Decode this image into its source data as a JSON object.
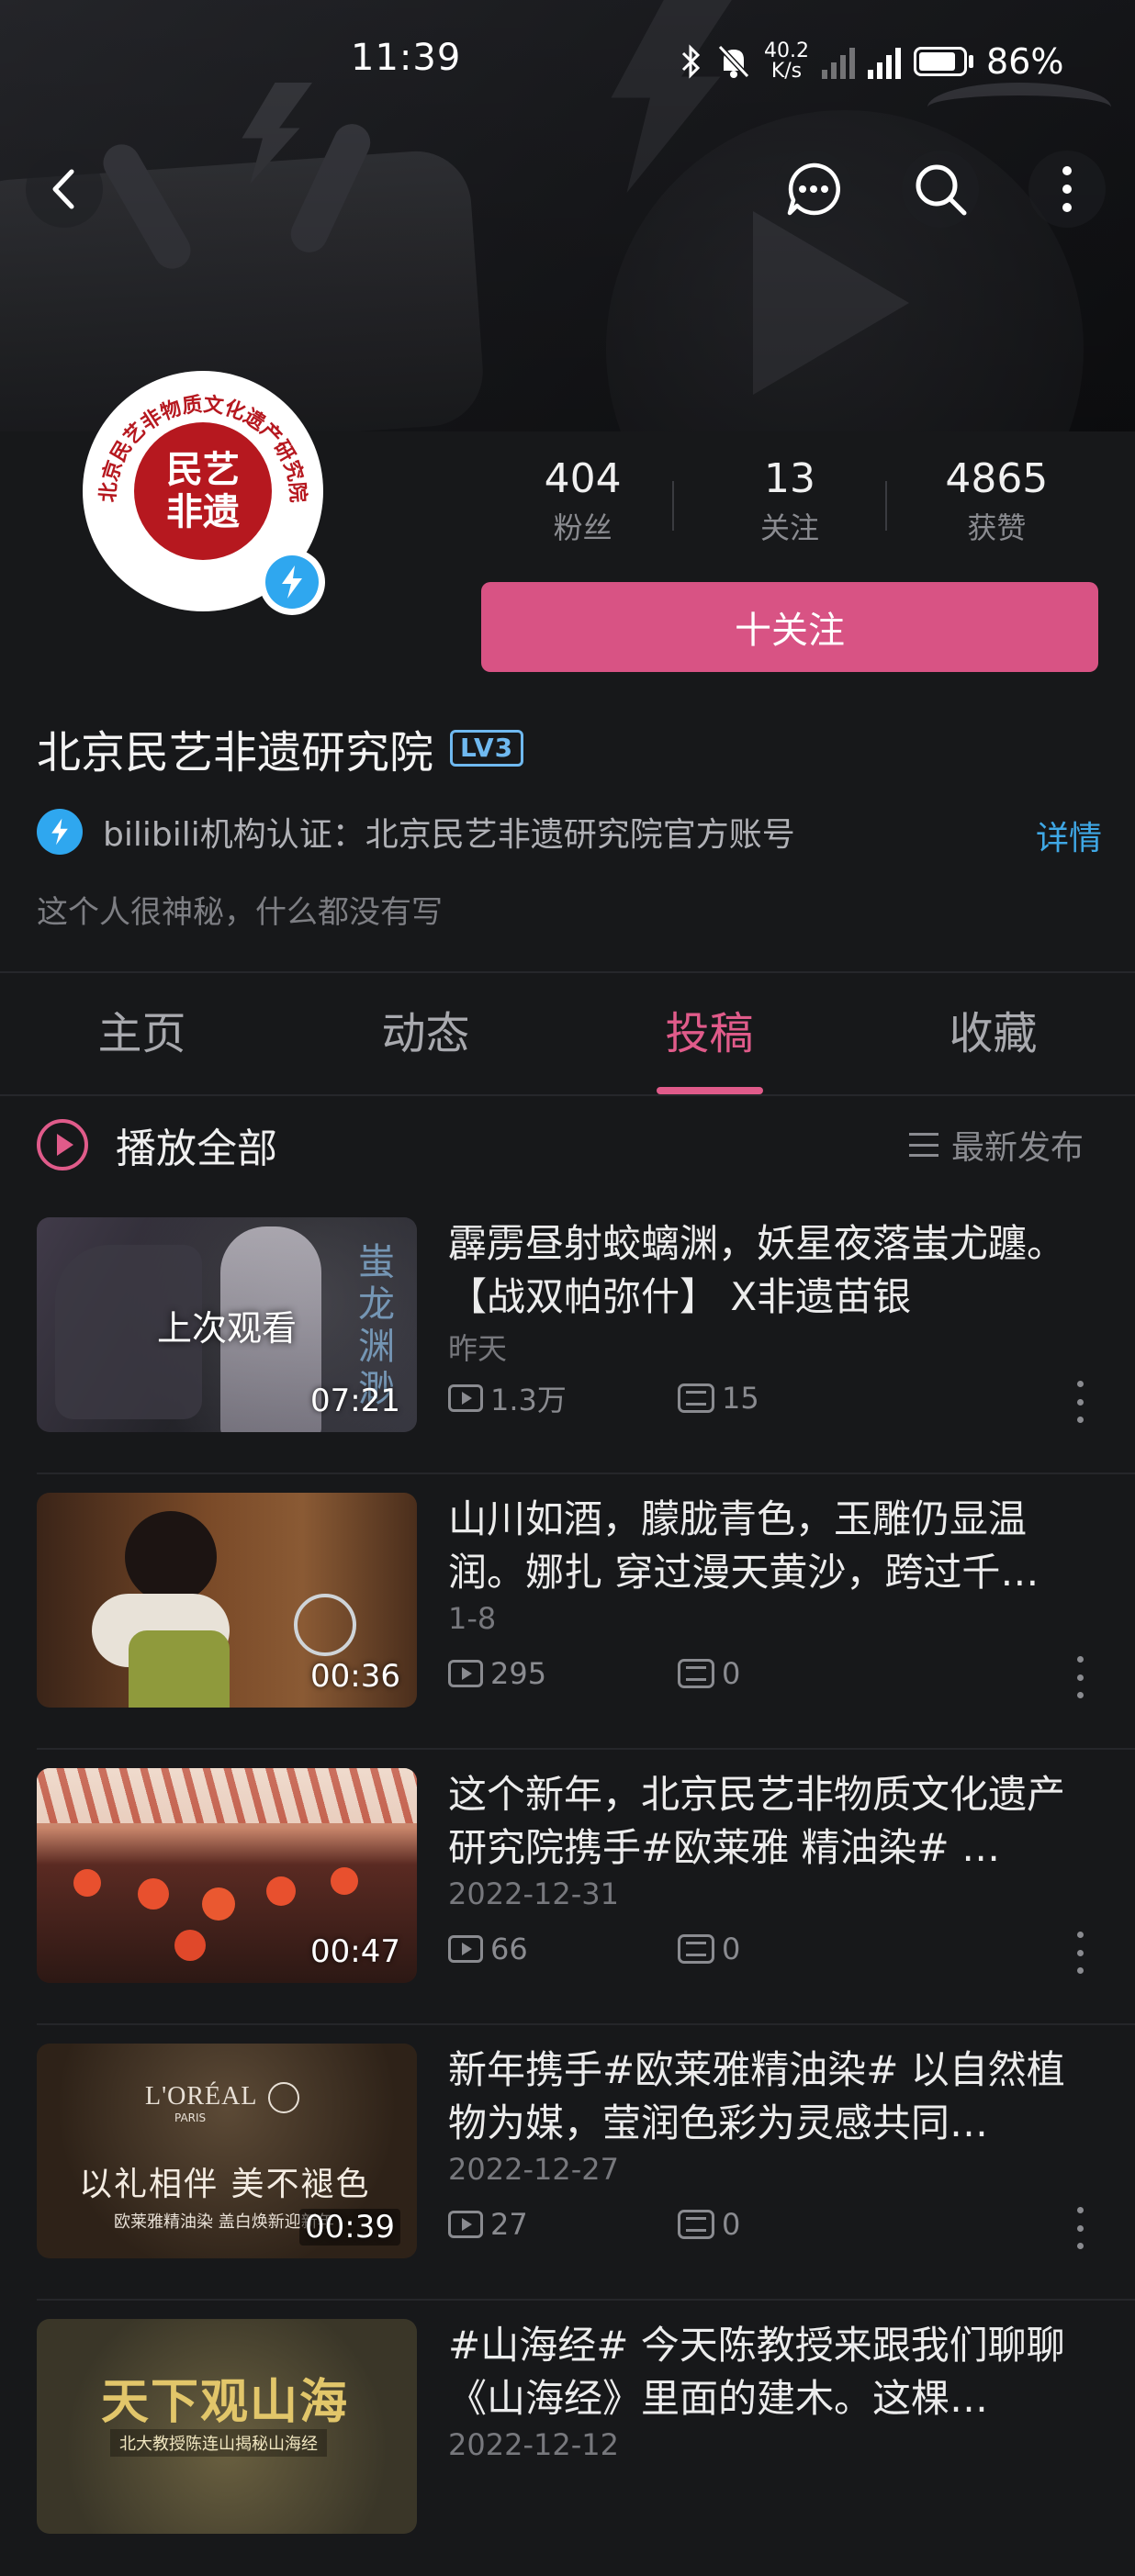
{
  "status_bar": {
    "time": "11:39",
    "net_speed_top": "40.2",
    "net_speed_bottom": "K/s",
    "battery": "86%"
  },
  "nav": {
    "back_icon": "chevron-left-icon",
    "chat_icon": "chat-bubble-icon",
    "search_icon": "search-icon",
    "more_icon": "more-vertical-icon"
  },
  "profile": {
    "seal_text": "民艺非遗",
    "seal_ring_text": "北京民艺非物质文化遗产研究院",
    "stats": [
      {
        "value": "404",
        "label": "粉丝"
      },
      {
        "value": "13",
        "label": "关注"
      },
      {
        "value": "4865",
        "label": "获赞"
      }
    ],
    "follow_label": "十关注",
    "name": "北京民艺非遗研究院",
    "level": "LV3",
    "cert_text": "bilibili机构认证：北京民艺非遗研究院官方账号",
    "cert_more": "详情",
    "bio": "这个人很神秘，什么都没有写",
    "accent": "#d85384"
  },
  "tabs": [
    {
      "label": "主页"
    },
    {
      "label": "动态"
    },
    {
      "label": "投稿"
    },
    {
      "label": "收藏"
    }
  ],
  "list_header": {
    "play_all": "播放全部",
    "sort": "最新发布"
  },
  "videos": [
    {
      "title": "霹雳昼射蛟螭渊，妖星夜落蚩尤躔。【战双帕弥什】 X非遗苗银",
      "date": "昨天",
      "views": "1.3万",
      "danmaku": "15",
      "duration": "07:21",
      "overlay": "上次观看",
      "thumb_text": "蚩龙渊渺"
    },
    {
      "title": "山川如酒，朦胧青色，玉雕仍显温润。娜扎 穿过漫天黄沙，跨过千…",
      "date": "1-8",
      "views": "295",
      "danmaku": "0",
      "duration": "00:36"
    },
    {
      "title": "这个新年，北京民艺非物质文化遗产研究院携手#欧莱雅 精油染# …",
      "date": "2022-12-31",
      "views": "66",
      "danmaku": "0",
      "duration": "00:47"
    },
    {
      "title": "新年携手#欧莱雅精油染# 以自然植物为媒，莹润色彩为灵感共同…",
      "date": "2022-12-27",
      "views": "27",
      "danmaku": "0",
      "duration": "00:39",
      "thumb_brand": "L'ORÉAL",
      "thumb_brand_sub": "PARIS",
      "thumb_text": "以礼相伴 美不褪色",
      "thumb_sub": "欧莱雅精油染 盖白焕新迎新年"
    },
    {
      "title": "#山海经# 今天陈教授来跟我们聊聊《山海经》里面的建木。这棵…",
      "date": "2022-12-12",
      "thumb_text": "天下观山海",
      "thumb_sub": "北大教授陈连山揭秘山海经"
    }
  ]
}
